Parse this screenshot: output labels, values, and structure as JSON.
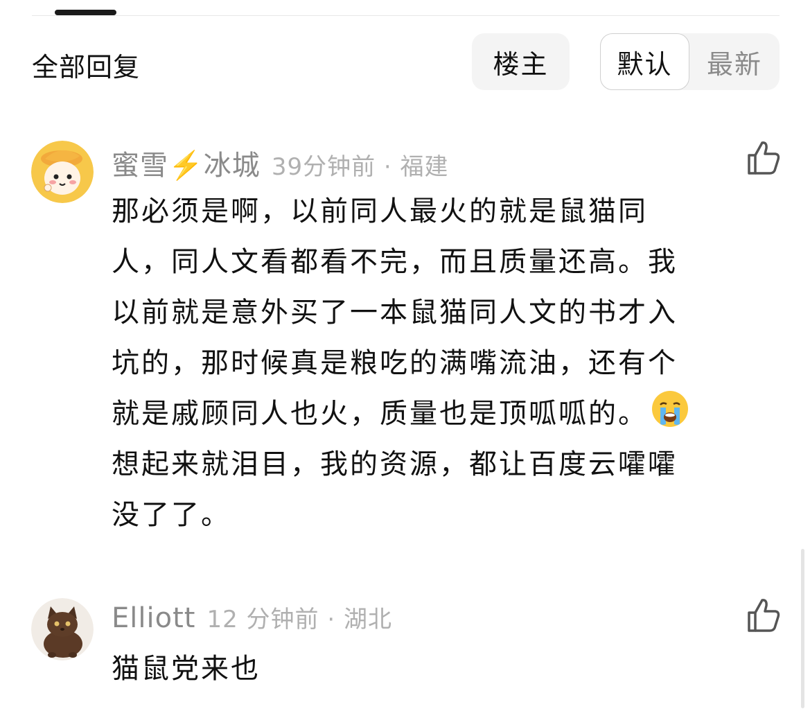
{
  "header": {
    "section_title": "全部回复",
    "filter_op_label": "楼主",
    "sort": {
      "selected": "默认",
      "options": [
        "默认",
        "最新"
      ]
    }
  },
  "comments": [
    {
      "username": "蜜雪⚡️冰城",
      "time_location": "39分钟前 · 福建",
      "content_lines": [
        "那必须是啊，以前同人最火的就是鼠猫同",
        "人，同人文看都看不完，而且质量还高。我",
        "以前就是意外买了一本鼠猫同人文的书才入",
        "坑的，那时候真是粮吃的满嘴流油，还有个",
        "就是戚顾同人也火，质量也是顶呱呱的。",
        "想起来就泪目，我的资源，都让百度云嚯嚯",
        "没了了。"
      ],
      "emoji": "loudly-crying-face",
      "avatar": "cartoon-girl-with-yellow-hat",
      "like_icon": "thumbs-up-icon"
    },
    {
      "username": "Elliott",
      "time_location": "12 分钟前 · 湖北",
      "content_lines": [
        "猫鼠党来也"
      ],
      "avatar": "brown-kitten-photo",
      "like_icon": "thumbs-up-icon"
    }
  ],
  "colors": {
    "username": "#8a8a8a",
    "meta": "#b0b0b0",
    "text": "#111111",
    "pill_bg": "#f4f4f4"
  }
}
